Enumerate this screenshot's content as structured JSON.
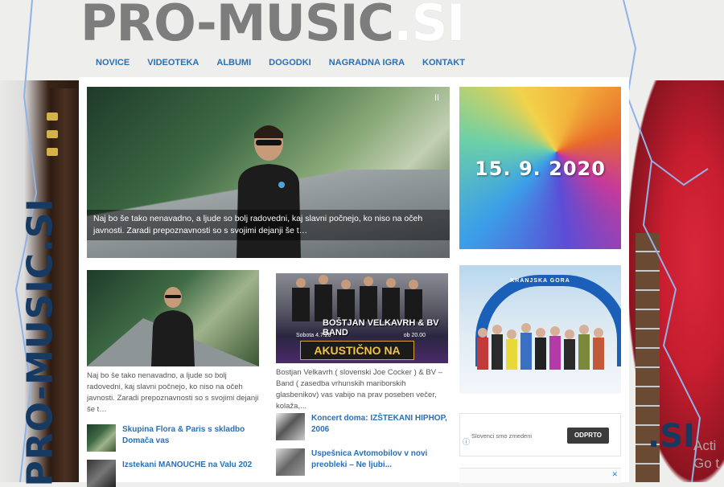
{
  "site": {
    "logo_main": "PRO-MUSIC",
    "logo_suffix": ".SI",
    "vertical_brand": "PRO-MUSIC.SI",
    "right_brand": ".SI"
  },
  "nav": {
    "items": [
      {
        "label": "NOVICE"
      },
      {
        "label": "VIDEOTEKA"
      },
      {
        "label": "ALBUMI"
      },
      {
        "label": "DOGODKI"
      },
      {
        "label": "NAGRADNA IGRA"
      },
      {
        "label": "KONTAKT"
      }
    ]
  },
  "slider": {
    "caption": "Naj bo še tako nenavadno, a ljude so bolj radovedni, kaj slavni počnejo, ko niso na očeh javnosti. Zaradi prepoznavnosti so s svojimi dejanji še t…",
    "pause_glyph": "II"
  },
  "ads": {
    "date_banner": "15. 9. 2020",
    "winter_label": "KRANJSKA GORA",
    "notification_text": "Slovenci smo zmedeni",
    "notification_button": "ODPRTO",
    "info_glyph": "ⓘ",
    "close_glyph": "✕"
  },
  "cards": [
    {
      "text": "Naj bo še tako nenavadno, a ljude so bolj radovedni, kaj slavni počnejo, ko niso na očeh javnosti. Zaradi prepoznavnosti so s svojimi dejanji še t…"
    },
    {
      "text": "Bostjan Velkavrh ( slovenski Joe Cocker ) & BV – Band ( zasedba vrhunskih mariborskih glasbenikov) vas vabijo na prav poseben večer, kolaža,...",
      "poster_title": "BOŠTJAN VELKAVRH & BV BAND",
      "poster_date": "Sobota 4.7.20",
      "poster_time": "ob 20.00",
      "poster_event": "AKUSTIČNO NA DRAVI"
    }
  ],
  "news_left": [
    {
      "title": "Skupina Flora & Paris s skladbo Domača vas"
    },
    {
      "title": "Izstekani MANOUCHE na Valu 202"
    }
  ],
  "news_right": [
    {
      "title": "Koncert doma: IZŠTEKANI HIPHOP, 2006"
    },
    {
      "title": "Uspešnica Avtomobilov v novi preobleki – Ne ljubi..."
    }
  ],
  "overlay": {
    "line1": "Acti",
    "line2": "Go t"
  },
  "colors": {
    "nav_link": "#2a6fb3",
    "brand_dark": "#173a63",
    "logo_grey": "#7d7d7d"
  }
}
